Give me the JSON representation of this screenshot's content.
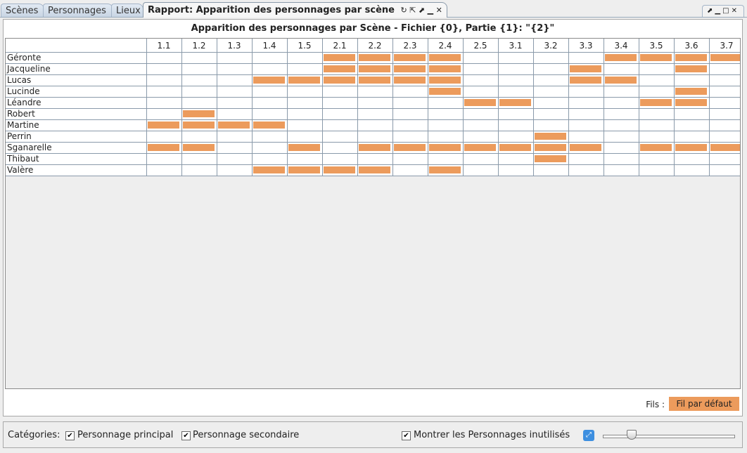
{
  "tabs": [
    {
      "label": "Scènes"
    },
    {
      "label": "Personnages"
    },
    {
      "label": "Lieux"
    },
    {
      "label": "Rapport: Apparition des personnages par scène"
    }
  ],
  "tab_controls": "↻ ⇱ ⬈ ▁ ✕",
  "window_controls": "⬈▁□✕",
  "report": {
    "title": "Apparition des personnages par Scène - Fichier {0}, Partie {1}: \"{2}\"",
    "bar_color": "#ec9b5c"
  },
  "chart_data": {
    "type": "table",
    "scenes": [
      "1.1",
      "1.2",
      "1.3",
      "1.4",
      "1.5",
      "2.1",
      "2.2",
      "2.3",
      "2.4",
      "2.5",
      "3.1",
      "3.2",
      "3.3",
      "3.4",
      "3.5",
      "3.6",
      "3.7"
    ],
    "rows": [
      {
        "name": "Géronte",
        "appears": [
          0,
          0,
          0,
          0,
          0,
          1,
          1,
          1,
          1,
          0,
          0,
          0,
          0,
          1,
          1,
          1,
          1
        ]
      },
      {
        "name": "Jacqueline",
        "appears": [
          0,
          0,
          0,
          0,
          0,
          1,
          1,
          1,
          1,
          0,
          0,
          0,
          1,
          0,
          0,
          1,
          0
        ]
      },
      {
        "name": "Lucas",
        "appears": [
          0,
          0,
          0,
          1,
          1,
          1,
          1,
          1,
          1,
          0,
          0,
          0,
          1,
          1,
          0,
          0,
          0
        ]
      },
      {
        "name": "Lucinde",
        "appears": [
          0,
          0,
          0,
          0,
          0,
          0,
          0,
          0,
          1,
          0,
          0,
          0,
          0,
          0,
          0,
          1,
          0
        ]
      },
      {
        "name": "Léandre",
        "appears": [
          0,
          0,
          0,
          0,
          0,
          0,
          0,
          0,
          0,
          1,
          1,
          0,
          0,
          0,
          1,
          1,
          0
        ]
      },
      {
        "name": "Robert",
        "appears": [
          0,
          1,
          0,
          0,
          0,
          0,
          0,
          0,
          0,
          0,
          0,
          0,
          0,
          0,
          0,
          0,
          0
        ]
      },
      {
        "name": "Martine",
        "appears": [
          1,
          1,
          1,
          1,
          0,
          0,
          0,
          0,
          0,
          0,
          0,
          0,
          0,
          0,
          0,
          0,
          0
        ]
      },
      {
        "name": "Perrin",
        "appears": [
          0,
          0,
          0,
          0,
          0,
          0,
          0,
          0,
          0,
          0,
          0,
          1,
          0,
          0,
          0,
          0,
          0
        ]
      },
      {
        "name": "Sganarelle",
        "appears": [
          1,
          1,
          0,
          0,
          1,
          0,
          1,
          1,
          1,
          1,
          1,
          1,
          1,
          0,
          1,
          1,
          1
        ]
      },
      {
        "name": "Thibaut",
        "appears": [
          0,
          0,
          0,
          0,
          0,
          0,
          0,
          0,
          0,
          0,
          0,
          1,
          0,
          0,
          0,
          0,
          0
        ]
      },
      {
        "name": "Valère",
        "appears": [
          0,
          0,
          0,
          1,
          1,
          1,
          1,
          0,
          1,
          0,
          0,
          0,
          0,
          0,
          0,
          0,
          0
        ]
      }
    ]
  },
  "fils": {
    "label": "Fils :",
    "button": "Fil par défaut"
  },
  "bottom": {
    "categories_label": "Catégories:",
    "principal": "Personnage principal",
    "secondaire": "Personnage secondaire",
    "show_unused": "Montrer les Personnages inutilisés",
    "check_mark": "✔"
  },
  "zoom": {
    "level": 0.2
  }
}
